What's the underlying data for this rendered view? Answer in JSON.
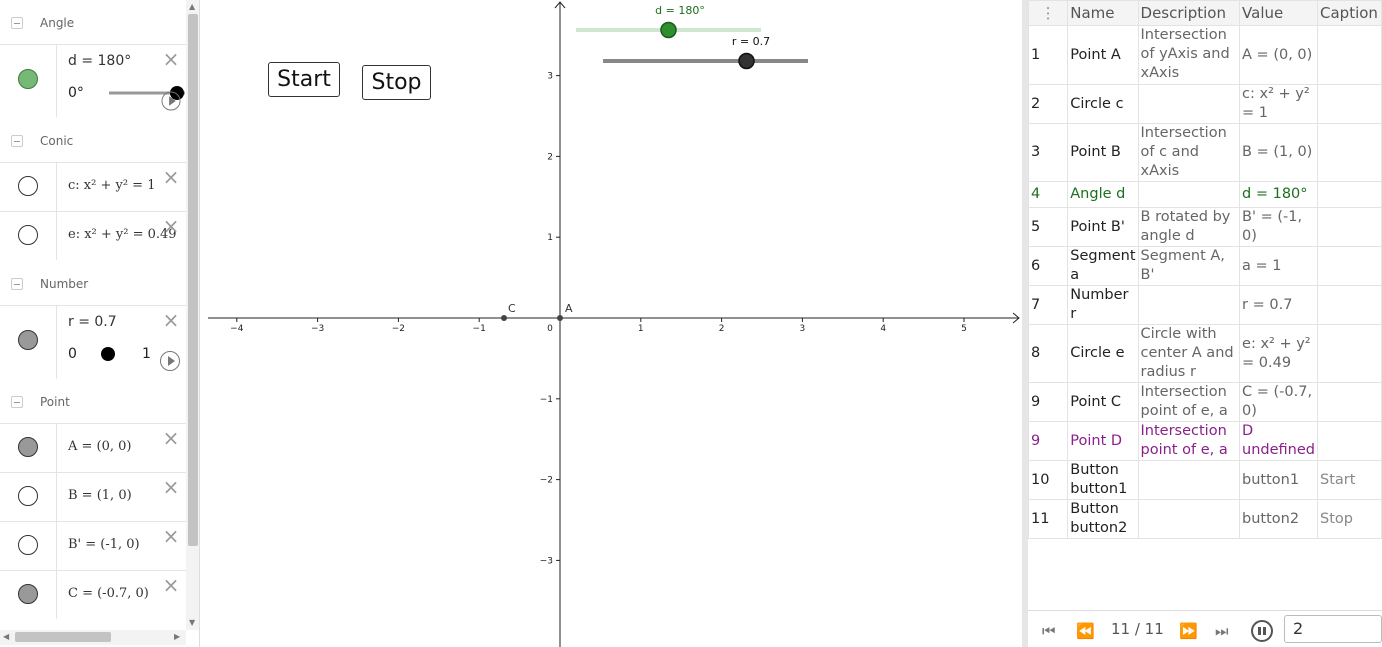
{
  "algebra": {
    "groups": {
      "angle": "Angle",
      "conic": "Conic",
      "number": "Number",
      "point": "Point"
    },
    "angle_d": {
      "expr": "d = 180°",
      "slider_min": "0°",
      "slider_value_fraction": 1.0,
      "color": "#76b876"
    },
    "conic_c": {
      "expr": "c: x² + y² = 1"
    },
    "conic_e": {
      "expr": "e: x² + y² = 0.49"
    },
    "number_r": {
      "expr": "r = 0.7",
      "slider_min": "0",
      "slider_max": "1",
      "slider_value_fraction": 0.7
    },
    "point_A": {
      "expr": "A = (0, 0)"
    },
    "point_B": {
      "expr": "B = (1, 0)"
    },
    "point_B1": {
      "expr": "B' = (-1, 0)"
    },
    "point_C": {
      "expr": "C = (-0.7, 0)"
    },
    "delete_glyph": "×"
  },
  "graphics": {
    "buttons": {
      "start": "Start",
      "stop": "Stop"
    },
    "slider_d": {
      "label": "d = 180°",
      "fraction": 0.5,
      "color": "#1a6e1a"
    },
    "slider_r": {
      "label": "r = 0.7",
      "fraction": 0.7
    },
    "axes": {
      "x_ticks": [
        "−4",
        "−3",
        "−2",
        "−1",
        "0",
        "1",
        "2",
        "3",
        "4",
        "5"
      ],
      "y_ticks": [
        "3",
        "2",
        "1",
        "−1",
        "−2",
        "−3"
      ]
    },
    "points": {
      "A": "A",
      "C": "C"
    }
  },
  "protocol": {
    "headers": {
      "name": "Name",
      "description": "Description",
      "value": "Value",
      "caption": "Caption"
    },
    "rows": [
      {
        "no": "1",
        "name": "Point A",
        "desc": "Intersection of yAxis and xAxis",
        "value": "A = (0, 0)",
        "caption": ""
      },
      {
        "no": "2",
        "name": "Circle c",
        "desc": "",
        "value": "c: x² + y² = 1",
        "caption": ""
      },
      {
        "no": "3",
        "name": "Point B",
        "desc": "Intersection of c and xAxis",
        "value": "B = (1, 0)",
        "caption": ""
      },
      {
        "no": "4",
        "name": "Angle d",
        "desc": "",
        "value": "d = 180°",
        "caption": ""
      },
      {
        "no": "5",
        "name": "Point B'",
        "desc": "B rotated by angle d",
        "value": "B' = (-1, 0)",
        "caption": ""
      },
      {
        "no": "6",
        "name": "Segment a",
        "desc": "Segment A, B'",
        "value": "a = 1",
        "caption": ""
      },
      {
        "no": "7",
        "name": "Number r",
        "desc": "",
        "value": "r = 0.7",
        "caption": ""
      },
      {
        "no": "8",
        "name": "Circle e",
        "desc": "Circle with center A and radius r",
        "value": "e: x² + y² = 0.49",
        "caption": ""
      },
      {
        "no": "9",
        "name": "Point C",
        "desc": "Intersection point of e, a",
        "value": "C = (-0.7, 0)",
        "caption": ""
      },
      {
        "no": "9",
        "name": "Point D",
        "desc": "Intersection point of e, a",
        "value": "D undefined",
        "caption": ""
      },
      {
        "no": "10",
        "name": "Button button1",
        "desc": "",
        "value": "button1",
        "caption": "Start"
      },
      {
        "no": "11",
        "name": "Button button2",
        "desc": "",
        "value": "button2",
        "caption": "Stop"
      }
    ],
    "nav": {
      "count": "11 / 11",
      "speed": "2"
    }
  },
  "colors": {
    "green": "#1c6f1c",
    "purple": "#8b1f8b",
    "gray_dot": "#999999"
  }
}
